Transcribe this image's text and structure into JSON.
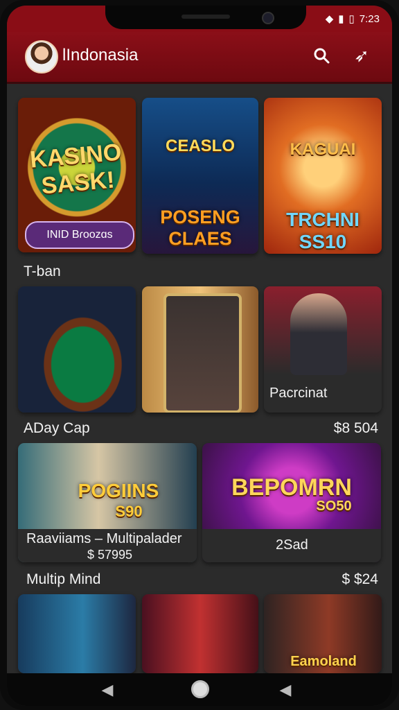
{
  "status": {
    "time": "7:23",
    "icons": [
      "wifi-icon",
      "signal-icon",
      "battery-icon"
    ]
  },
  "appbar": {
    "title": "lIndonasia",
    "avatar": "avatar",
    "search_icon": "search-icon",
    "rocket_icon": "rocket-icon"
  },
  "sections": [
    {
      "label": "T-ban",
      "cards": [
        {
          "title": "KASINO SASK!",
          "pill": "INID Bɾoozɑs"
        },
        {
          "title": "CEASLO",
          "subtitle": "POSENG CLAES"
        },
        {
          "title": "KAGUAI",
          "subtitle": "TRCHNI SS10"
        }
      ]
    },
    {
      "label": "ADay Cap",
      "price": "$8 504",
      "cards": [
        {
          "title": "",
          "caption": ""
        },
        {
          "title": "",
          "caption": ""
        },
        {
          "title": "",
          "caption": "Pacrcinat"
        }
      ]
    },
    {
      "label": "Multip Mind",
      "price": "$ $24",
      "cards": [
        {
          "title": "POGIINS",
          "subtitle": "S90",
          "caption": "Raaviiams – Multipalader",
          "caption_price": "$ 57995"
        },
        {
          "title": "BEPOMRN",
          "subtitle": "SO50",
          "caption": "2Sad"
        }
      ]
    },
    {
      "label": "",
      "cards": [
        {
          "title": ""
        },
        {
          "title": ""
        },
        {
          "title": "Eamoland"
        }
      ]
    }
  ],
  "nav": {
    "back": "◀",
    "home": "",
    "recent": "◀"
  }
}
